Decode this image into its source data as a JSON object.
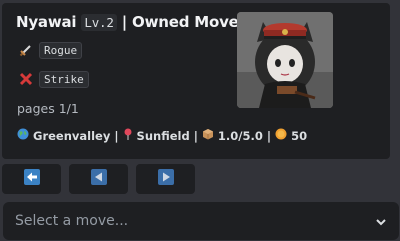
{
  "embed": {
    "name": "Nyawai",
    "level": "Lv.2",
    "title_suffix": "| Owned Moves",
    "class_tag": "Rogue",
    "move_tag": "Strike",
    "pages": "pages 1/1",
    "stats": {
      "region": "Greenvalley",
      "sep1": "|",
      "town": "Sunfield",
      "sep2": "|",
      "weight": "1.0/5.0",
      "sep3": "|",
      "coins": "50"
    }
  },
  "select": {
    "placeholder": "Select a move..."
  },
  "buttons": {
    "first": "back-arrow",
    "prev": "previous",
    "next": "next"
  },
  "colors": {
    "button_icon": "#3b82c4",
    "background": "#323339",
    "embed": "#1e1f22"
  }
}
